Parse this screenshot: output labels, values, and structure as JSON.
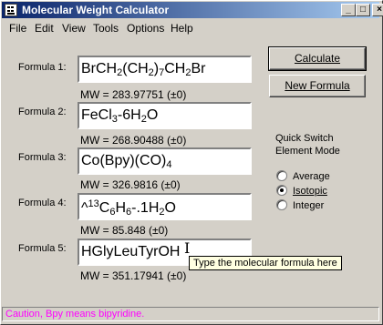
{
  "window": {
    "title": "Molecular Weight Calculator"
  },
  "titlebar_buttons": {
    "minimize": "_",
    "maximize": "□",
    "close": "×"
  },
  "menu": {
    "file": "File",
    "edit": "Edit",
    "view": "View",
    "tools": "Tools",
    "options": "Options",
    "help": "Help"
  },
  "formulas": [
    {
      "label": "Formula 1:",
      "mw": "MW = 283.97751 (±0)"
    },
    {
      "label": "Formula 2:",
      "mw": "MW = 268.90488 (±0)"
    },
    {
      "label": "Formula 3:",
      "mw": "MW = 326.9816 (±0)"
    },
    {
      "label": "Formula 4:",
      "mw": "MW = 85.848 (±0)"
    },
    {
      "label": "Formula 5:",
      "value": "HGlyLeuTyrOH",
      "mw": "MW = 351.17941 (±0)"
    }
  ],
  "formula_parts": {
    "f1": [
      "BrCH",
      "2",
      "(CH",
      "2",
      ")",
      "7",
      "CH",
      "2",
      "Br"
    ],
    "f2": [
      "FeCl",
      "3",
      "-6H",
      "2",
      "O"
    ],
    "f3": [
      "Co(Bpy)(CO)",
      "4"
    ],
    "f4": [
      "^",
      "13",
      "C",
      "6",
      "H",
      "6",
      "-.1H",
      "2",
      "O"
    ]
  },
  "buttons": {
    "calculate": "Calculate",
    "new_formula": "New Formula"
  },
  "quick_switch": {
    "line1": "Quick Switch",
    "line2": "Element Mode",
    "options": [
      "Average",
      "Isotopic",
      "Integer"
    ],
    "selected": "Isotopic"
  },
  "tooltip": "Type the molecular formula here",
  "status": "Caution, Bpy means bipyridine.",
  "colors": {
    "title_start": "#0a246a",
    "title_end": "#a6caf0",
    "status_text": "#ff00ff",
    "tooltip_bg": "#ffffe1"
  }
}
